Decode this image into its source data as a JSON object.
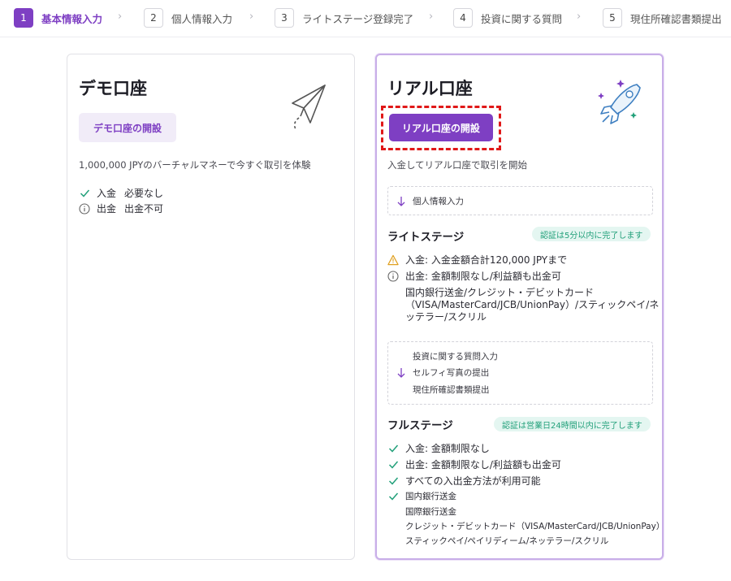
{
  "stepper": {
    "steps": [
      {
        "num": "1",
        "label": "基本情報入力"
      },
      {
        "num": "2",
        "label": "個人情報入力"
      },
      {
        "num": "3",
        "label": "ライトステージ登録完了"
      },
      {
        "num": "4",
        "label": "投資に関する質問"
      },
      {
        "num": "5",
        "label": "現住所確認書類提出"
      }
    ],
    "active_step": "1"
  },
  "demo": {
    "title": "デモ口座",
    "button": "デモ口座の開設",
    "subtitle": "1,000,000 JPYのバーチャルマネーで今すぐ取引を体験",
    "deposit_label": "入金",
    "deposit_value": "必要なし",
    "withdraw_label": "出金",
    "withdraw_value": "出金不可",
    "icon": "paper-plane-icon"
  },
  "real": {
    "title": "リアル口座",
    "button": "リアル口座の開設",
    "subtitle": "入金してリアル口座で取引を開始",
    "icon": "rocket-icon",
    "step_personal": "個人情報入力",
    "light": {
      "title": "ライトステージ",
      "badge": "認証は5分以内に完了します",
      "deposit": "入金: 入金金額合計120,000 JPYまで",
      "withdraw": "出金: 金額制限なし/利益額も出金可",
      "methods_line1": "国内銀行送金/クレジット・デビットカード",
      "methods_line2": "（VISA/MasterCard/JCB/UnionPay）/スティックペイ/ネ",
      "methods_line3": "ッテラー/スクリル"
    },
    "full_steps": [
      "投資に関する質問入力",
      "セルフィ写真の提出",
      "現住所確認書類提出"
    ],
    "full": {
      "title": "フルステージ",
      "badge": "認証は営業日24時間以内に完了します",
      "deposit": "入金: 金額制限なし",
      "withdraw": "出金: 金額制限なし/利益額も出金可",
      "all_methods": "すべての入出金方法が利用可能",
      "methods": [
        "国内銀行送金",
        "国際銀行送金",
        "クレジット・デビットカード（VISA/MasterCard/JCB/UnionPay）",
        "スティックペイ/ペイリディーム/ネッテラー/スクリル"
      ]
    }
  },
  "colors": {
    "accent": "#7e3fc3",
    "check": "#22a07a",
    "warning": "#e0a020",
    "badge_bg": "#e4f6f1",
    "highlight": "#e01818"
  }
}
